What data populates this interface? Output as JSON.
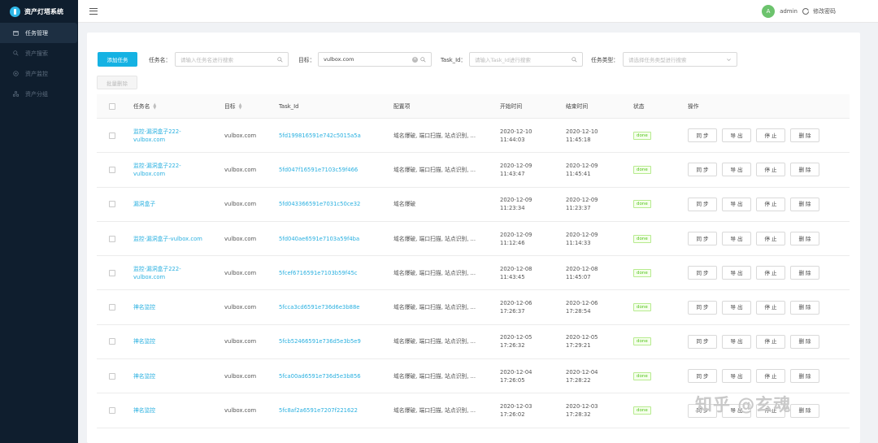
{
  "app": {
    "title": "资产灯塔系统"
  },
  "sidebar": {
    "items": [
      {
        "label": "任务管理",
        "icon": "calendar-icon",
        "active": true
      },
      {
        "label": "资产搜索",
        "icon": "search-icon",
        "active": false
      },
      {
        "label": "资产监控",
        "icon": "target-icon",
        "active": false
      },
      {
        "label": "资产分组",
        "icon": "group-icon",
        "active": false
      }
    ]
  },
  "header": {
    "user": "admin",
    "avatar_letter": "A",
    "change_password": "修改密码",
    "avatar_color": "#6cc36d"
  },
  "toolbar": {
    "add_task": "添加任务",
    "batch_delete": "批量删除",
    "task_name_label": "任务名：",
    "task_name_placeholder": "请输入任务名进行搜索",
    "target_label": "目标：",
    "target_value": "vulbox.com",
    "task_id_label": "Task_Id：",
    "task_id_placeholder": "请输入Task_Id进行搜索",
    "task_type_label": "任务类型：",
    "task_type_placeholder": "请选择任务类型进行搜索"
  },
  "table": {
    "headers": {
      "name": "任务名",
      "target": "目标",
      "task_id": "Task_Id",
      "config": "配置项",
      "start": "开始时间",
      "end": "结束时间",
      "status": "状态",
      "ops": "操作"
    },
    "op_labels": {
      "sync": "同 步",
      "export": "导 出",
      "stop": "停 止",
      "delete": "删 除"
    },
    "rows": [
      {
        "name1": "监控-漏洞盒子222-",
        "name2": "vulbox.com",
        "target": "vulbox.com",
        "task_id": "5fd199816591e742c5015a5a",
        "config": "域名爆破, 端口扫描, 站点识别, ...",
        "start_date": "2020-12-10",
        "start_time": "11:44:03",
        "end_date": "2020-12-10",
        "end_time": "11:45:18",
        "status": "done"
      },
      {
        "name1": "监控-漏洞盒子222-",
        "name2": "vulbox.com",
        "target": "vulbox.com",
        "task_id": "5fd047f16591e7103c59f466",
        "config": "域名爆破, 端口扫描, 站点识别, ...",
        "start_date": "2020-12-09",
        "start_time": "11:43:47",
        "end_date": "2020-12-09",
        "end_time": "11:45:41",
        "status": "done"
      },
      {
        "name1": "漏洞盒子",
        "name2": "",
        "target": "vulbox.com",
        "task_id": "5fd043366591e7031c50ce32",
        "config": "域名爆破",
        "start_date": "2020-12-09",
        "start_time": "11:23:34",
        "end_date": "2020-12-09",
        "end_time": "11:23:37",
        "status": "done"
      },
      {
        "name1": "监控-漏洞盒子-vulbox.com",
        "name2": "",
        "target": "vulbox.com",
        "task_id": "5fd040ae6591e7103a59f4ba",
        "config": "域名爆破, 端口扫描, 站点识别, ...",
        "start_date": "2020-12-09",
        "start_time": "11:12:46",
        "end_date": "2020-12-09",
        "end_time": "11:14:33",
        "status": "done"
      },
      {
        "name1": "监控-漏洞盒子222-",
        "name2": "vulbox.com",
        "target": "vulbox.com",
        "task_id": "5fcef6716591e7103b59f45c",
        "config": "域名爆破, 端口扫描, 站点识别, ...",
        "start_date": "2020-12-08",
        "start_time": "11:43:45",
        "end_date": "2020-12-08",
        "end_time": "11:45:07",
        "status": "done"
      },
      {
        "name1": "神名监控",
        "name2": "",
        "target": "vulbox.com",
        "task_id": "5fcca3cd6591e736d6e3b88e",
        "config": "域名爆破, 端口扫描, 站点识别, ...",
        "start_date": "2020-12-06",
        "start_time": "17:26:37",
        "end_date": "2020-12-06",
        "end_time": "17:28:54",
        "status": "done"
      },
      {
        "name1": "神名监控",
        "name2": "",
        "target": "vulbox.com",
        "task_id": "5fcb52466591e736d5e3b5e9",
        "config": "域名爆破, 端口扫描, 站点识别, ...",
        "start_date": "2020-12-05",
        "start_time": "17:26:32",
        "end_date": "2020-12-05",
        "end_time": "17:29:21",
        "status": "done"
      },
      {
        "name1": "神名监控",
        "name2": "",
        "target": "vulbox.com",
        "task_id": "5fca00ad6591e736d5e3b856",
        "config": "域名爆破, 端口扫描, 站点识别, ...",
        "start_date": "2020-12-04",
        "start_time": "17:26:05",
        "end_date": "2020-12-04",
        "end_time": "17:28:22",
        "status": "done"
      },
      {
        "name1": "神名监控",
        "name2": "",
        "target": "vulbox.com",
        "task_id": "5fc8af2a6591e7207f221622",
        "config": "域名爆破, 端口扫描, 站点识别, ...",
        "start_date": "2020-12-03",
        "start_time": "17:26:02",
        "end_date": "2020-12-03",
        "end_time": "17:28:32",
        "status": "done"
      }
    ]
  },
  "watermark": "知乎 @玄魂",
  "colors": {
    "sidebar": "#0f1e2e",
    "primary": "#15b2e3",
    "link": "#2ab0e0",
    "tag_green": "#52c41a"
  }
}
